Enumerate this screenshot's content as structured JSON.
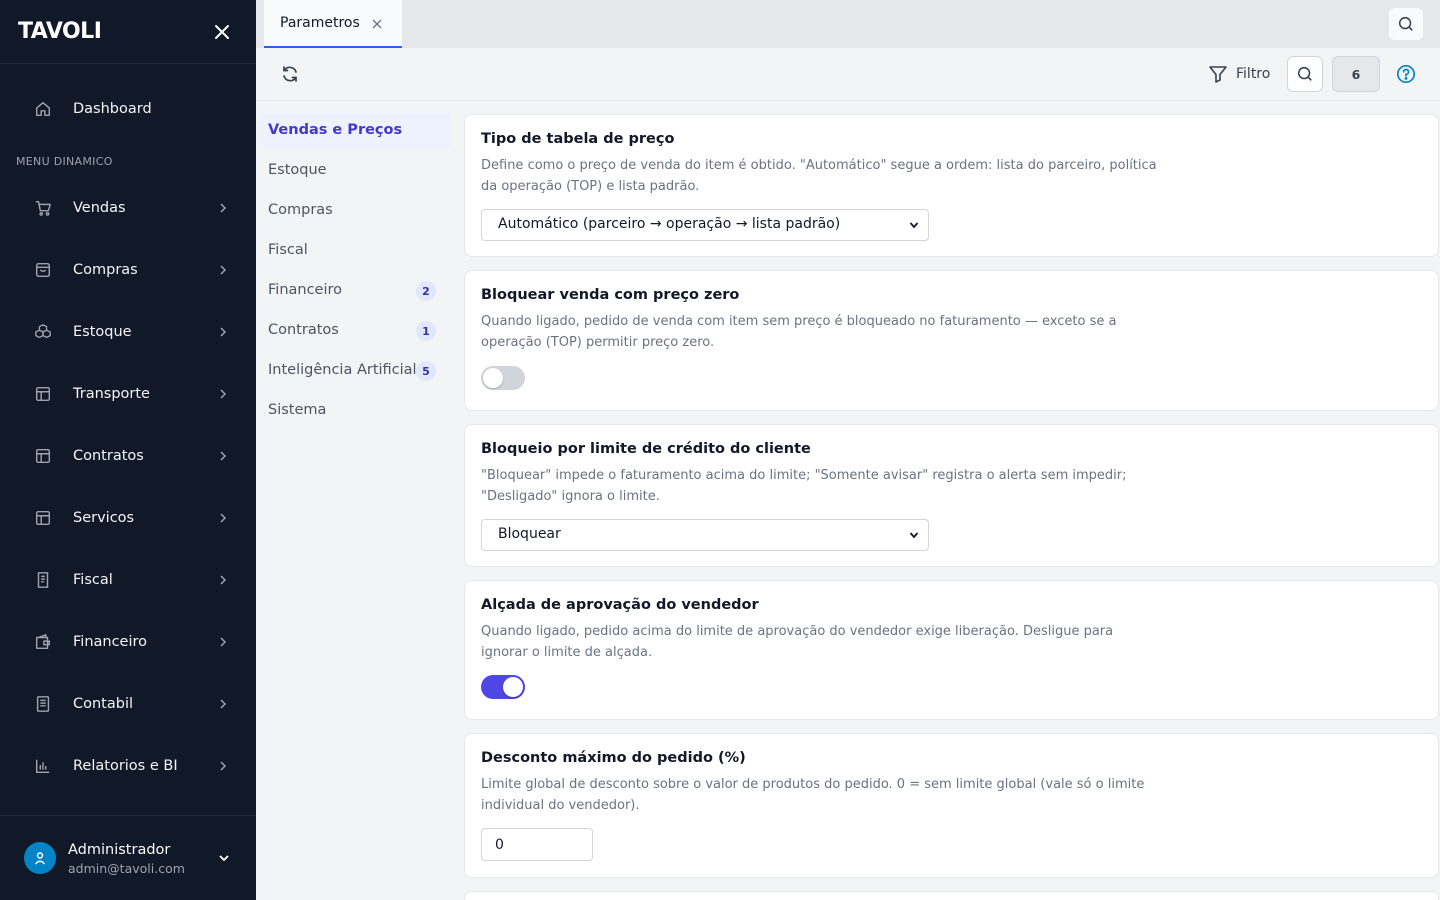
{
  "app": {
    "logo": "TAVOLI"
  },
  "sidebar": {
    "dashboard": "Dashboard",
    "section_label": "MENU DINAMICO",
    "items": [
      {
        "label": "Vendas",
        "icon": "cart-icon"
      },
      {
        "label": "Compras",
        "icon": "shopping-bag-icon"
      },
      {
        "label": "Estoque",
        "icon": "boxes-icon"
      },
      {
        "label": "Transporte",
        "icon": "layout-icon"
      },
      {
        "label": "Contratos",
        "icon": "layout-icon"
      },
      {
        "label": "Servicos",
        "icon": "layout-icon"
      },
      {
        "label": "Fiscal",
        "icon": "receipt-icon"
      },
      {
        "label": "Financeiro",
        "icon": "wallet-icon"
      },
      {
        "label": "Contabil",
        "icon": "ledger-icon"
      },
      {
        "label": "Relatorios e BI",
        "icon": "bar-chart-icon"
      }
    ],
    "user": {
      "name": "Administrador",
      "email": "admin@tavoli.com"
    }
  },
  "tabs": [
    {
      "label": "Parametros",
      "active": true
    }
  ],
  "toolbar": {
    "filter_label": "Filtro",
    "count": "6"
  },
  "categories": [
    {
      "label": "Vendas e Preços",
      "active": true
    },
    {
      "label": "Estoque"
    },
    {
      "label": "Compras"
    },
    {
      "label": "Fiscal"
    },
    {
      "label": "Financeiro",
      "badge": "2"
    },
    {
      "label": "Contratos",
      "badge": "1"
    },
    {
      "label": "Inteligência Artificial",
      "badge": "5"
    },
    {
      "label": "Sistema"
    }
  ],
  "settings": [
    {
      "title": "Tipo de tabela de preço",
      "description": "Define como o preço de venda do item é obtido. \"Automático\" segue a ordem: lista do parceiro, política da operação (TOP) e lista padrão.",
      "control": "select",
      "value": "Automático (parceiro → operação → lista padrão)"
    },
    {
      "title": "Bloquear venda com preço zero",
      "description": "Quando ligado, pedido de venda com item sem preço é bloqueado no faturamento — exceto se a operação (TOP) permitir preço zero.",
      "control": "toggle",
      "value": false
    },
    {
      "title": "Bloqueio por limite de crédito do cliente",
      "description": "\"Bloquear\" impede o faturamento acima do limite; \"Somente avisar\" registra o alerta sem impedir; \"Desligado\" ignora o limite.",
      "control": "select",
      "value": "Bloquear"
    },
    {
      "title": "Alçada de aprovação do vendedor",
      "description": "Quando ligado, pedido acima do limite de aprovação do vendedor exige liberação. Desligue para ignorar o limite de alçada.",
      "control": "toggle",
      "value": true
    },
    {
      "title": "Desconto máximo do pedido (%)",
      "description": "Limite global de desconto sobre o valor de produtos do pedido. 0 = sem limite global (vale só o limite individual do vendedor).",
      "control": "number",
      "value": "0"
    }
  ],
  "colors": {
    "sidebar_bg": "#111827",
    "accent": "#4f46e5",
    "tab_underline": "#2563eb",
    "avatar": "#0284c7"
  }
}
